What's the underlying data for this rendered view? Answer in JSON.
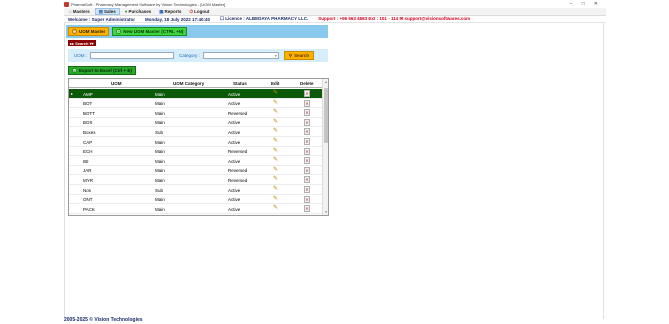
{
  "window": {
    "title": "PharmaSoft - Pharmacy Management Software by Vision Technologies - [UOM Master]",
    "controls": [
      "−",
      "□",
      "✕"
    ]
  },
  "menu": [
    {
      "label": "Masters",
      "icon": "home-icon"
    },
    {
      "label": "Sales",
      "icon": "sales-icon",
      "active": true
    },
    {
      "label": "Purchases",
      "icon": "purchase-icon"
    },
    {
      "label": "Reports",
      "icon": "reports-icon"
    },
    {
      "label": "Logout",
      "icon": "logout-icon"
    }
  ],
  "info": {
    "welcome": "Welcome : Super Administrator",
    "date": "Monday, 18 July 2022 17:40:40",
    "licence": "☐ Licence : ALBEDAYA PHARMACY LLC.",
    "support": "Support : +96 563 4683 Ext : 101 - 114 ✉ support@visionsoftwares.com"
  },
  "toolbar": {
    "uom_master_label": "UOM Master",
    "new_uom_label": "New UOM Master (CTRL +N)"
  },
  "search": {
    "section_label": "▸▸ Search ▾▾",
    "uom_label": "UOM :",
    "uom_value": "",
    "category_label": "Category :",
    "category_value": "",
    "button_label": "Search"
  },
  "export": {
    "label": "Export to Excel (Ctrl + E)"
  },
  "grid": {
    "columns": [
      "UOM",
      "UOM Category",
      "Status",
      "Edit",
      "Delete"
    ],
    "rows": [
      {
        "uom": "AMP",
        "category": "Main",
        "status": "Active"
      },
      {
        "uom": "BOT",
        "category": "Main",
        "status": "Active"
      },
      {
        "uom": "BOTT",
        "category": "Main",
        "status": "Reversed"
      },
      {
        "uom": "BOX",
        "category": "Main",
        "status": "Active"
      },
      {
        "uom": "Boxes",
        "category": "Sub",
        "status": "Active"
      },
      {
        "uom": "CAP",
        "category": "Main",
        "status": "Active"
      },
      {
        "uom": "ECH",
        "category": "Main",
        "status": "Reversed"
      },
      {
        "uom": "IBI",
        "category": "Main",
        "status": "Active"
      },
      {
        "uom": "JAR",
        "category": "Main",
        "status": "Reversed"
      },
      {
        "uom": "MYR",
        "category": "Main",
        "status": "Reversed"
      },
      {
        "uom": "Nos",
        "category": "Sub",
        "status": "Active"
      },
      {
        "uom": "ONT",
        "category": "Main",
        "status": "Active"
      },
      {
        "uom": "PACK",
        "category": "Main",
        "status": "Active"
      }
    ],
    "selected_index": 0
  },
  "footer": {
    "text": "2005-2025 © Vision Technologies"
  },
  "colors": {
    "toolstrip": "#89c9ee",
    "accent_orange": "#ffb300",
    "accent_green": "#3fd43f",
    "selected_row": "#0a5a0a",
    "support_red": "#d4001f"
  }
}
